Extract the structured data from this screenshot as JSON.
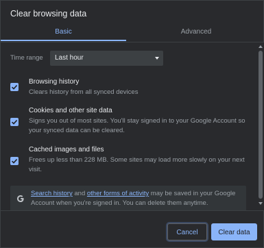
{
  "dialog": {
    "title": "Clear browsing data"
  },
  "tabs": [
    {
      "label": "Basic",
      "active": true
    },
    {
      "label": "Advanced",
      "active": false
    }
  ],
  "time_range": {
    "label": "Time range",
    "value": "Last hour"
  },
  "options": [
    {
      "title": "Browsing history",
      "description": "Clears history from all synced devices",
      "checked": true
    },
    {
      "title": "Cookies and other site data",
      "description": "Signs you out of most sites. You'll stay signed in to your Google Account so your synced data can be cleared.",
      "checked": true
    },
    {
      "title": "Cached images and files",
      "description": "Frees up less than 228 MB. Some sites may load more slowly on your next visit.",
      "checked": true
    }
  ],
  "info": {
    "icon": "google-g-icon",
    "link1": "Search history",
    "text1": " and ",
    "link2": "other forms of activity",
    "text2": " may be saved in your Google Account when you're signed in. You can delete them anytime."
  },
  "footer": {
    "cancel_label": "Cancel",
    "clear_label": "Clear data"
  },
  "colors": {
    "accent": "#8ab4f8",
    "background": "#292a2d",
    "text": "#e8eaed",
    "muted": "#9aa0a6"
  }
}
